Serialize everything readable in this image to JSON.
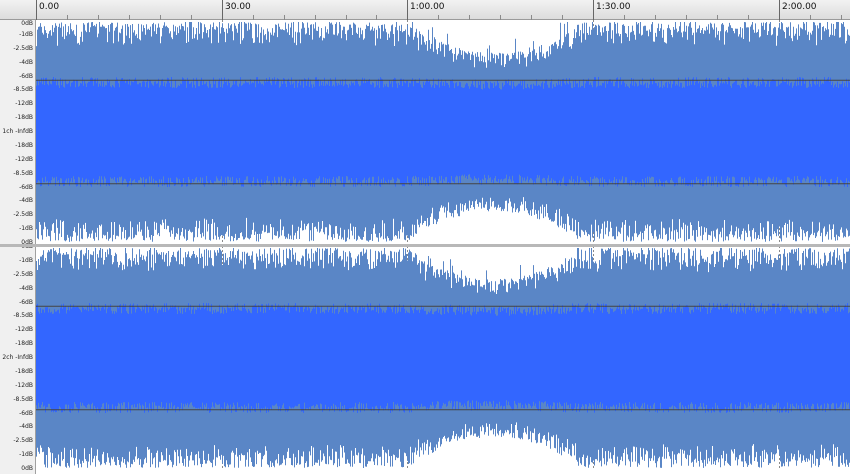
{
  "ruler": {
    "labels": [
      "0.00",
      "30.00",
      "1:00.00",
      "1:30.00",
      "2:00.00"
    ],
    "label_seconds": [
      0,
      30,
      60,
      90,
      120
    ],
    "minor_every_seconds": 5,
    "visible_seconds": 131.5
  },
  "tracks": [
    {
      "name": "1ch",
      "db_labels": [
        "0dB",
        "-1dB",
        "-2.5dB",
        "-4dB",
        "-6dB",
        "-8.5dB",
        "-12dB",
        "-18dB",
        "1ch -InfdB",
        "-18dB",
        "-12dB",
        "-8.5dB",
        "-6dB",
        "-4dB",
        "-2.5dB",
        "-1dB",
        "0dB"
      ]
    },
    {
      "name": "2ch",
      "db_labels": [
        "0dB",
        "-1dB",
        "-2.5dB",
        "-4dB",
        "-6dB",
        "-8.5dB",
        "-12dB",
        "-18dB",
        "2ch -InfdB",
        "-18dB",
        "-12dB",
        "-8.5dB",
        "-6dB",
        "-4dB",
        "-2.5dB",
        "-1dB",
        "0dB"
      ]
    }
  ],
  "colors": {
    "waveform_fill": "#3366ff",
    "waveform_peaks": "#5a86c6",
    "gridline": "#444444",
    "beat_line": "#8a8a8a",
    "background": "#ffffff"
  }
}
